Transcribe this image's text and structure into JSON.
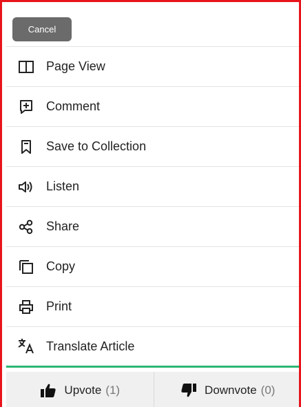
{
  "topbar": {
    "cancel_label": "Cancel"
  },
  "menu": {
    "items": [
      {
        "label": "Page View",
        "icon": "page-view-icon"
      },
      {
        "label": "Comment",
        "icon": "comment-icon"
      },
      {
        "label": "Save to Collection",
        "icon": "bookmark-icon"
      },
      {
        "label": "Listen",
        "icon": "speaker-icon"
      },
      {
        "label": "Share",
        "icon": "share-icon"
      },
      {
        "label": "Copy",
        "icon": "copy-icon"
      },
      {
        "label": "Print",
        "icon": "print-icon"
      },
      {
        "label": "Translate Article",
        "icon": "translate-icon"
      }
    ]
  },
  "votes": {
    "upvote_label": "Upvote",
    "upvote_count": "(1)",
    "downvote_label": "Downvote",
    "downvote_count": "(0)"
  },
  "colors": {
    "frame_border": "#e8141b",
    "cancel_bg": "#6b6b6b",
    "accent_divider": "#2bb673",
    "vote_bar_bg": "#f0f0f0"
  }
}
